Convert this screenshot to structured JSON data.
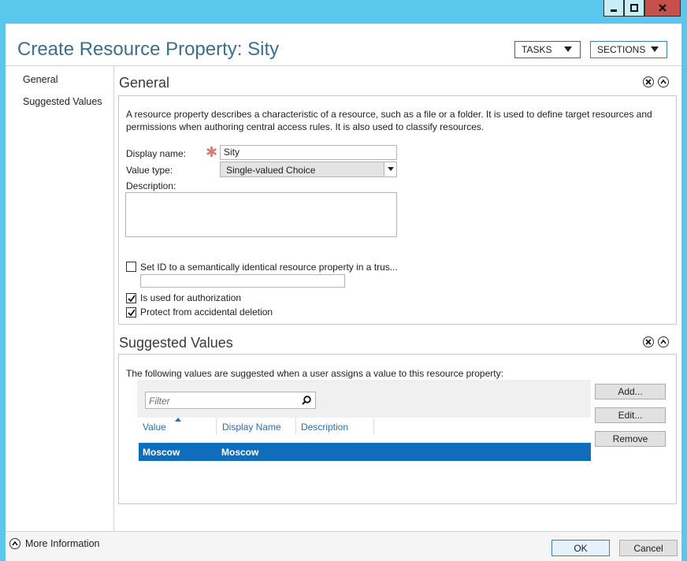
{
  "window_controls": {
    "minimize_icon": "minimize-icon",
    "maximize_icon": "maximize-icon",
    "close_icon": "close-icon"
  },
  "header": {
    "title": "Create Resource Property: Sity",
    "tasks_label": "TASKS",
    "sections_label": "SECTIONS"
  },
  "nav": {
    "items": [
      {
        "label": "General"
      },
      {
        "label": "Suggested Values"
      }
    ]
  },
  "general": {
    "title": "General",
    "description_text_line1": "A resource property describes a characteristic of a resource, such as a file or a folder. It is used to define target resources and",
    "description_text_line2": "permissions when authoring central access rules. It is also used to classify resources.",
    "display_name_label": "Display name:",
    "display_name_value": "Sity",
    "required_marker": "✱",
    "value_type_label": "Value type:",
    "value_type_value": "Single-valued Choice",
    "description_label": "Description:",
    "description_value": "",
    "set_id_label": "Set ID to a semantically identical resource property in a trus...",
    "set_id_value": "",
    "authorization_label": "Is used for authorization",
    "protect_label": "Protect from accidental deletion",
    "checkboxes": {
      "set_id": false,
      "authorization": true,
      "protect": true
    }
  },
  "suggested": {
    "title": "Suggested Values",
    "intro": "The following values are suggested when a user assigns a value to this resource property:",
    "filter_placeholder": "Filter",
    "columns": [
      "Value",
      "Display Name",
      "Description"
    ],
    "rows": [
      {
        "value": "Moscow",
        "display_name": "Moscow",
        "description": ""
      }
    ],
    "buttons": {
      "add": "Add...",
      "edit": "Edit...",
      "remove": "Remove"
    }
  },
  "footer": {
    "more_info": "More Information",
    "ok": "OK",
    "cancel": "Cancel"
  },
  "colors": {
    "title": "#3d6f87",
    "selection": "#0f6dbb",
    "required": "#e07a7a",
    "desktop": "#5ac8ea"
  }
}
